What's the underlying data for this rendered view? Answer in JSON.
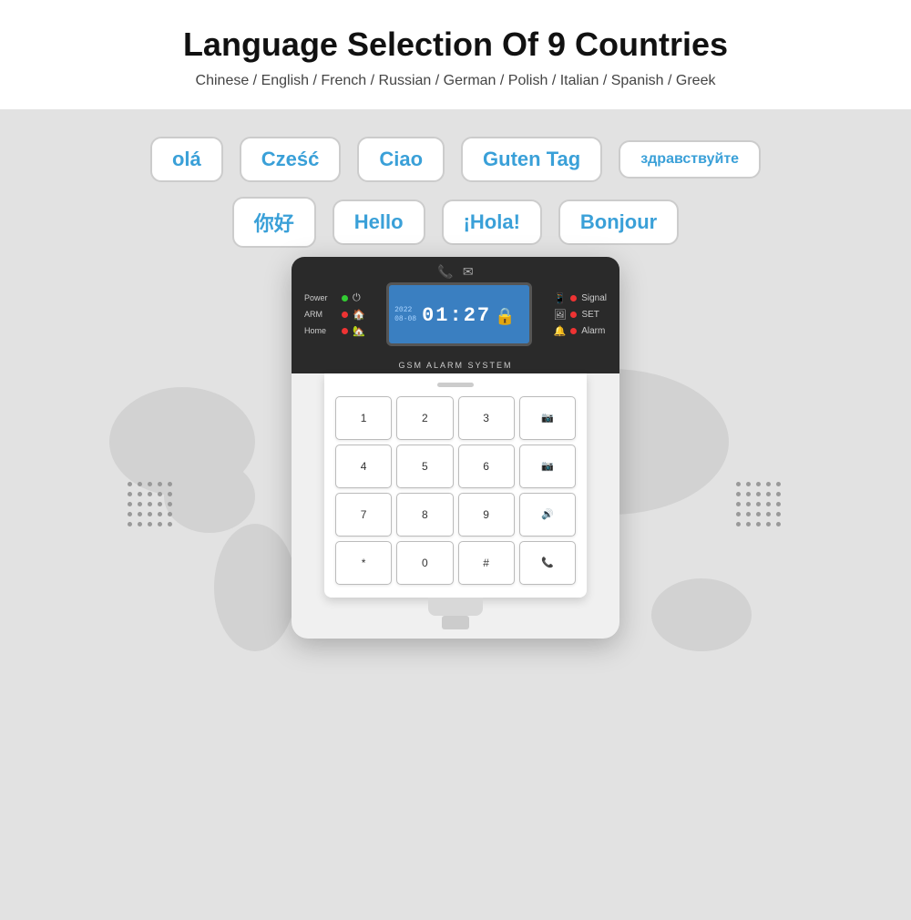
{
  "header": {
    "title": "Language Selection Of 9 Countries",
    "subtitle": "Chinese / English / French / Russian / German / Polish / Italian / Spanish / Greek"
  },
  "greetings": {
    "row1": [
      {
        "id": "ola",
        "text": "olá"
      },
      {
        "id": "czesc",
        "text": "Cześć"
      },
      {
        "id": "ciao",
        "text": "Ciao"
      },
      {
        "id": "guten-tag",
        "text": "Guten Tag"
      },
      {
        "id": "zdravstvuyte",
        "text": "здравствуйте"
      }
    ],
    "row2": [
      {
        "id": "nihao",
        "text": "你好"
      },
      {
        "id": "hello",
        "text": "Hello"
      },
      {
        "id": "hola",
        "text": "¡Hola!"
      },
      {
        "id": "bonjour",
        "text": "Bonjour"
      }
    ]
  },
  "device": {
    "left_indicators": [
      {
        "label": "Power",
        "color": "green",
        "icon": "⏻"
      },
      {
        "label": "ARM",
        "color": "red",
        "icon": "🏠"
      },
      {
        "label": "Home",
        "color": "red",
        "icon": "🏠"
      }
    ],
    "lcd": {
      "date": "2022\n08-08",
      "time": "01:27",
      "lock_icon": "🔒"
    },
    "right_indicators": [
      {
        "label": "Signal",
        "icon": "📶"
      },
      {
        "label": "SET",
        "icon": "🖼"
      },
      {
        "label": "Alarm",
        "icon": "🚨"
      }
    ],
    "label": "GSM ALARM SYSTEM",
    "keypad": {
      "keys": [
        "1",
        "2",
        "3",
        "📷",
        "4",
        "5",
        "6",
        "📷",
        "7",
        "8",
        "9",
        "🔊",
        "*",
        "0",
        "#",
        "📞"
      ]
    }
  }
}
